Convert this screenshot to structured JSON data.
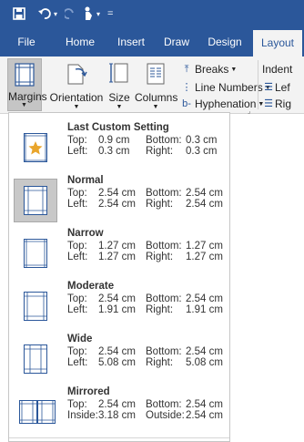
{
  "colors": {
    "brand": "#2b579a",
    "ribbon": "#f3f3f3",
    "selected": "#c8c8c8"
  },
  "titlebar": {
    "icons": [
      "save-icon",
      "undo-icon",
      "redo-icon",
      "touch-mode-icon",
      "customize-toolbar-icon"
    ]
  },
  "tabs": [
    "File",
    "Home",
    "Insert",
    "Draw",
    "Design",
    "Layout"
  ],
  "ribbon": {
    "margins": "Margins",
    "orientation": "Orientation",
    "size": "Size",
    "columns": "Columns",
    "breaks": "Breaks",
    "line_numbers": "Line Numbers",
    "hyphenation": "Hyphenation",
    "indent": "Indent",
    "left_short": "Lef",
    "right_short": "Rig"
  },
  "margin_options": [
    {
      "name": "Last Custom Setting",
      "l1a": "Top:",
      "l1b": "0.9 cm",
      "l1c": "Bottom:",
      "l1d": "0.3 cm",
      "l2a": "Left:",
      "l2b": "0.3 cm",
      "l2c": "Right:",
      "l2d": "0.3 cm"
    },
    {
      "name": "Normal",
      "l1a": "Top:",
      "l1b": "2.54 cm",
      "l1c": "Bottom:",
      "l1d": "2.54 cm",
      "l2a": "Left:",
      "l2b": "2.54 cm",
      "l2c": "Right:",
      "l2d": "2.54 cm"
    },
    {
      "name": "Narrow",
      "l1a": "Top:",
      "l1b": "1.27 cm",
      "l1c": "Bottom:",
      "l1d": "1.27 cm",
      "l2a": "Left:",
      "l2b": "1.27 cm",
      "l2c": "Right:",
      "l2d": "1.27 cm"
    },
    {
      "name": "Moderate",
      "l1a": "Top:",
      "l1b": "2.54 cm",
      "l1c": "Bottom:",
      "l1d": "2.54 cm",
      "l2a": "Left:",
      "l2b": "1.91 cm",
      "l2c": "Right:",
      "l2d": "1.91 cm"
    },
    {
      "name": "Wide",
      "l1a": "Top:",
      "l1b": "2.54 cm",
      "l1c": "Bottom:",
      "l1d": "2.54 cm",
      "l2a": "Left:",
      "l2b": "5.08 cm",
      "l2c": "Right:",
      "l2d": "5.08 cm"
    },
    {
      "name": "Mirrored",
      "l1a": "Top:",
      "l1b": "2.54 cm",
      "l1c": "Bottom:",
      "l1d": "2.54 cm",
      "l2a": "Inside:",
      "l2b": "3.18 cm",
      "l2c": "Outside:",
      "l2d": "2.54 cm"
    }
  ]
}
